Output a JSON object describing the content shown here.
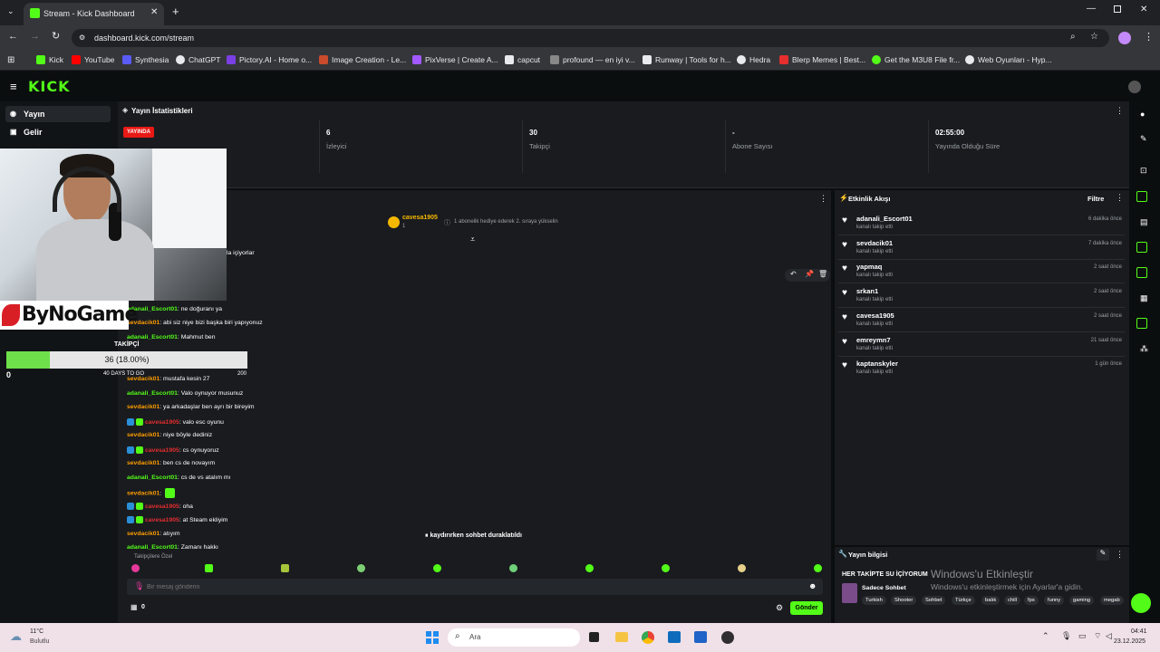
{
  "browser": {
    "tab_title": "Stream - Kick Dashboard",
    "url": "dashboard.kick.com/stream",
    "bookmarks": [
      {
        "label": "Kick",
        "color": "#53fc18"
      },
      {
        "label": "YouTube",
        "color": "#ff0000"
      },
      {
        "label": "Synthesia",
        "color": "#5b5bf5"
      },
      {
        "label": "ChatGPT",
        "color": "#e8eaed"
      },
      {
        "label": "Pictory.AI - Home o...",
        "color": "#7b3fe4"
      },
      {
        "label": "Image Creation - Le...",
        "color": "#c94b2c"
      },
      {
        "label": "PixVerse | Create A...",
        "color": "#a259ff"
      },
      {
        "label": "capcut",
        "color": "#e8eaed"
      },
      {
        "label": "profound — en iyi v...",
        "color": "#888888"
      },
      {
        "label": "Runway | Tools for h...",
        "color": "#e8eaed"
      },
      {
        "label": "Hedra",
        "color": "#e8eaed"
      },
      {
        "label": "Blerp Memes | Best...",
        "color": "#e52e2e"
      },
      {
        "label": "Get the M3U8 File fr...",
        "color": "#53fc18"
      },
      {
        "label": "Web Oyunları - Hyp...",
        "color": "#e8eaed"
      }
    ]
  },
  "kick": {
    "logo": "KICK"
  },
  "sidebar": {
    "items": [
      {
        "label": "Yayın",
        "icon": "broadcast-icon"
      },
      {
        "label": "Gelir",
        "icon": "revenue-icon"
      }
    ]
  },
  "stats": {
    "title": "Yayın İstatistikleri",
    "live_badge": "YAYINDA",
    "cards": [
      {
        "value": "6",
        "label": "İzleyici"
      },
      {
        "value": "30",
        "label": "Takipçi"
      },
      {
        "value": "-",
        "label": "Abone Sayısı"
      },
      {
        "value": "02:55:00",
        "label": "Yayında Olduğu Süre"
      }
    ]
  },
  "overlay": {
    "brand": "ByNoGame",
    "goal_title": "TAKİPÇİ",
    "goal_progress_text": "36 (18.00%)",
    "goal_progress_fraction": 0.18,
    "goal_min": "0",
    "goal_max": "200",
    "goal_days": "40 DAYS TO GO"
  },
  "chat": {
    "pinned_user": "cavesa1905",
    "pinned_count": "1",
    "pinned_text": "1 abonelik hediye ederek 2. sıraya yükselin",
    "partial_text": "la içiyorlar",
    "messages": [
      {
        "user": "adanali_Escort01",
        "color": "green",
        "text": ": ne doğuranı ya"
      },
      {
        "user": "sevdacik01",
        "color": "orange",
        "text": ": abi siz niye bizi başka biri yapıyonuz"
      },
      {
        "user": "adanali_Escort01",
        "color": "green",
        "text": ": Mahmut ben"
      },
      {
        "user": "sevdacik01",
        "color": "orange",
        "text": ": mustafa kesin 27"
      },
      {
        "user": "adanali_Escort01",
        "color": "green",
        "text": ": Valo oynuyor musunuz"
      },
      {
        "user": "sevdacik01",
        "color": "orange",
        "text": ": ya arkadaşlar ben ayrı bir bireyim"
      },
      {
        "user": "cavesa1905",
        "color": "red",
        "text": ": valo esc oyunu",
        "badges": true
      },
      {
        "user": "sevdacik01",
        "color": "orange",
        "text": ": niye böyle dediniz"
      },
      {
        "user": "cavesa1905",
        "color": "red",
        "text": ": cs oynuyoruz",
        "badges": true
      },
      {
        "user": "sevdacik01",
        "color": "orange",
        "text": ": ben cs de novayım"
      },
      {
        "user": "adanali_Escort01",
        "color": "green",
        "text": ": cs de vs atalım mı"
      },
      {
        "user": "sevdacik01",
        "color": "orange",
        "text": ":"
      },
      {
        "user": "cavesa1905",
        "color": "red",
        "text": ": oha",
        "badges": true
      },
      {
        "user": "cavesa1905",
        "color": "red",
        "text": ": at Steam ekliyim",
        "badges": true
      },
      {
        "user": "sevdacik01",
        "color": "orange",
        "text": ": atıyım"
      },
      {
        "user": "adanali_Escort01",
        "color": "green",
        "text": ": Zamanı hakkı"
      }
    ],
    "paused_text": "kaydırırken sohbet duraklatıldı",
    "followers_only": "Takipçilere Özel",
    "input_placeholder": "Bir mesaj gönderin",
    "count": "0",
    "send_label": "Gönder"
  },
  "activity": {
    "title": "Etkinlik Akışı",
    "filter_label": "Filtre",
    "subtitle": "kanalı takip etti",
    "events": [
      {
        "user": "adanali_Escort01",
        "time": "6 dakika önce"
      },
      {
        "user": "sevdacik01",
        "time": "7 dakika önce"
      },
      {
        "user": "yapmaq",
        "time": "2 saat önce"
      },
      {
        "user": "srkan1",
        "time": "2 saat önce"
      },
      {
        "user": "cavesa1905",
        "time": "2 saat önce"
      },
      {
        "user": "emreymn7",
        "time": "21 saat önce"
      },
      {
        "user": "kaptanskyler",
        "time": "1 gün önce"
      }
    ]
  },
  "stream_info": {
    "title": "Yayın bilgisi",
    "stream_title": "HER TAKİPTE SU İÇİYORUM",
    "category": "Sadece Sohbet",
    "tags": [
      "Turkish",
      "Shooter",
      "Sohbet",
      "Türkçe",
      "balık",
      "chill",
      "fps",
      "funny",
      "gaming",
      "megab"
    ]
  },
  "watermark": {
    "line1": "Windows'u Etkinleştir",
    "line2": "Windows'u etkinleştirmek için Ayarlar'a gidin."
  },
  "taskbar": {
    "weather_temp": "11°C",
    "weather_desc": "Bulutlu",
    "search_placeholder": "Ara",
    "time": "04:41",
    "date": "23.12.2025"
  }
}
